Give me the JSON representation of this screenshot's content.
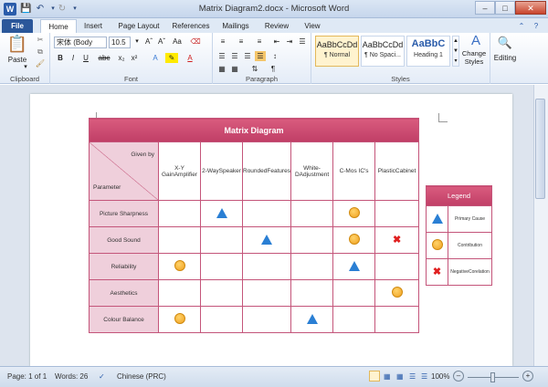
{
  "window": {
    "title": "Matrix Diagram2.docx - Microsoft Word",
    "app_icon": "W"
  },
  "tabs": [
    "File",
    "Home",
    "Insert",
    "Page Layout",
    "References",
    "Mailings",
    "Review",
    "View"
  ],
  "ribbon": {
    "paste_label": "Paste",
    "clipboard_label": "Clipboard",
    "font_name": "宋体 (Body Asia",
    "font_size": "10.5",
    "font_label": "Font",
    "paragraph_label": "Paragraph",
    "styles": [
      {
        "preview": "AaBbCcDd",
        "name": "¶ Normal"
      },
      {
        "preview": "AaBbCcDd",
        "name": "¶ No Spaci..."
      },
      {
        "preview": "AaBbC",
        "name": "Heading 1"
      }
    ],
    "change_styles_label": "Change Styles",
    "styles_label": "Styles",
    "editing_label": "Editing"
  },
  "matrix": {
    "title": "Matrix Diagram",
    "corner_top": "Given by",
    "corner_bottom": "Parameter",
    "columns": [
      "X-Y GainAmplifier",
      "2-WaySpeaker",
      "RoundedFeatures",
      "White-DAdjustment",
      "C-Mos IC's",
      "PlasticCabinet"
    ],
    "rows": [
      {
        "label": "Picture Sharpness",
        "cells": [
          "",
          "triangle",
          "",
          "",
          "circle",
          ""
        ]
      },
      {
        "label": "Good Sound",
        "cells": [
          "",
          "",
          "triangle",
          "",
          "circle",
          "cross"
        ]
      },
      {
        "label": "Reliability",
        "cells": [
          "circle",
          "",
          "",
          "",
          "triangle",
          ""
        ]
      },
      {
        "label": "Aesthetics",
        "cells": [
          "",
          "",
          "",
          "",
          "",
          "circle"
        ]
      },
      {
        "label": "Colour Balance",
        "cells": [
          "circle",
          "",
          "",
          "triangle",
          "",
          ""
        ]
      }
    ]
  },
  "legend": {
    "title": "Legend",
    "items": [
      {
        "symbol": "triangle",
        "label": "Primary Cause"
      },
      {
        "symbol": "circle",
        "label": "Contribution"
      },
      {
        "symbol": "cross",
        "label": "NegativeCorelation"
      }
    ]
  },
  "status": {
    "page": "Page: 1 of 1",
    "words": "Words: 26",
    "language": "Chinese (PRC)",
    "zoom": "100%"
  }
}
